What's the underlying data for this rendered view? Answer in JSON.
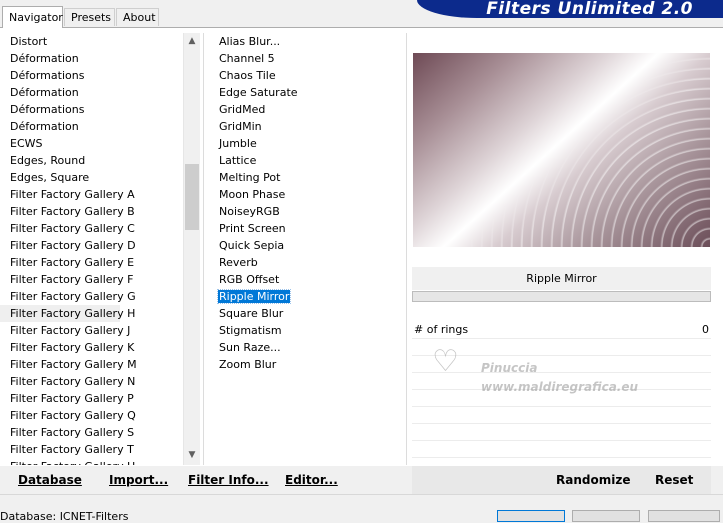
{
  "tabs": [
    {
      "label": "Navigator"
    },
    {
      "label": "Presets"
    },
    {
      "label": "About"
    }
  ],
  "banner": {
    "title": "Filters Unlimited 2.0"
  },
  "categories": [
    "Distort",
    "Déformation",
    "Déformations",
    "Déformation",
    "Déformations",
    "Déformation",
    "ECWS",
    "Edges, Round",
    "Edges, Square",
    "Filter Factory Gallery A",
    "Filter Factory Gallery B",
    "Filter Factory Gallery C",
    "Filter Factory Gallery D",
    "Filter Factory Gallery E",
    "Filter Factory Gallery F",
    "Filter Factory Gallery G",
    "Filter Factory Gallery H",
    "Filter Factory Gallery J",
    "Filter Factory Gallery K",
    "Filter Factory Gallery M",
    "Filter Factory Gallery N",
    "Filter Factory Gallery P",
    "Filter Factory Gallery Q",
    "Filter Factory Gallery S",
    "Filter Factory Gallery T",
    "Filter Factory Gallery U"
  ],
  "highlighted_category": "Filter Factory Gallery H",
  "scrollbar": {
    "up_icon": "▲",
    "down_icon": "▼"
  },
  "filters": [
    "Alias Blur...",
    "Channel 5",
    "Chaos Tile",
    "Edge Saturate",
    "GridMed",
    "GridMin",
    "Jumble",
    "Lattice",
    "Melting Pot",
    "Moon Phase",
    "NoiseyRGB",
    "Print Screen",
    "Quick Sepia",
    "Reverb",
    "RGB Offset",
    "Ripple Mirror",
    "Square Blur",
    "Stigmatism",
    "Sun Raze...",
    "Zoom Blur"
  ],
  "selected_filter": "Ripple Mirror",
  "preview": {
    "filter_name": "Ripple Mirror"
  },
  "params": [
    {
      "label": "# of rings",
      "value": "0"
    }
  ],
  "watermark": {
    "line1": "Pinuccia",
    "line2": "www.maldiregrafica.eu"
  },
  "bottom": {
    "database": "Database",
    "import": "Import...",
    "filter_info": "Filter Info...",
    "editor": "Editor...",
    "randomize": "Randomize",
    "reset": "Reset"
  },
  "status": {
    "text": "Database:  ICNET-Filters"
  }
}
